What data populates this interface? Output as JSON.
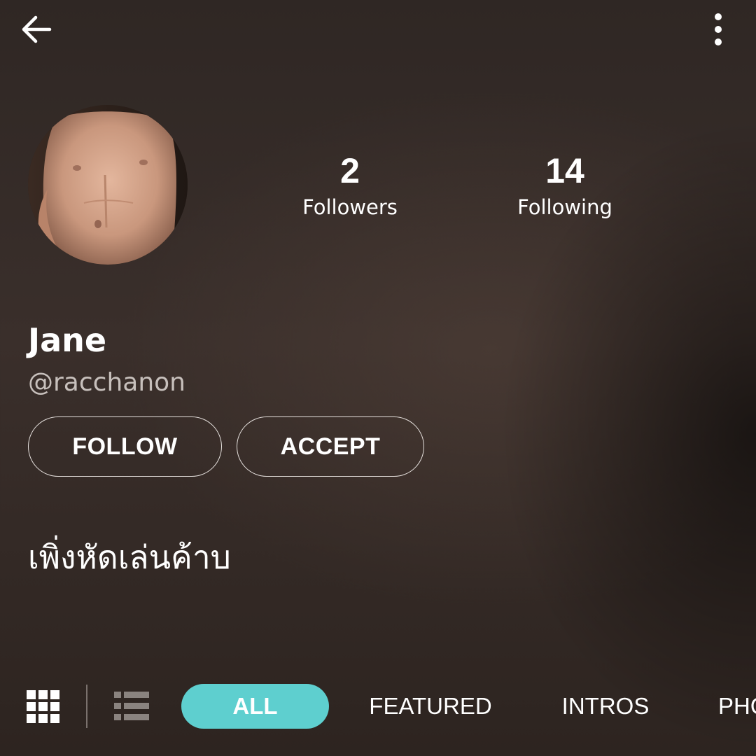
{
  "header": {
    "back_icon": "arrow-left-icon",
    "more_icon": "more-vertical-icon"
  },
  "profile": {
    "avatar_icon": "avatar-photo",
    "display_name": "Jane",
    "username": "@racchanon",
    "bio": "เพิ่งหัดเล่นค้าบ"
  },
  "stats": {
    "followers": {
      "count": "2",
      "label": "Followers"
    },
    "following": {
      "count": "14",
      "label": "Following"
    }
  },
  "actions": {
    "follow_label": "FOLLOW",
    "accept_label": "ACCEPT"
  },
  "view_toggle": {
    "grid_icon": "grid-view-icon",
    "list_icon": "list-view-icon",
    "active": "grid"
  },
  "tabs": [
    {
      "label": "ALL",
      "active": true
    },
    {
      "label": "FEATURED",
      "active": false
    },
    {
      "label": "INTROS",
      "active": false
    },
    {
      "label": "PHO",
      "active": false
    }
  ],
  "colors": {
    "accent": "#5ecfcf",
    "background": "#2f2724",
    "text": "#ffffff",
    "muted_text": "#c7c0bc"
  }
}
